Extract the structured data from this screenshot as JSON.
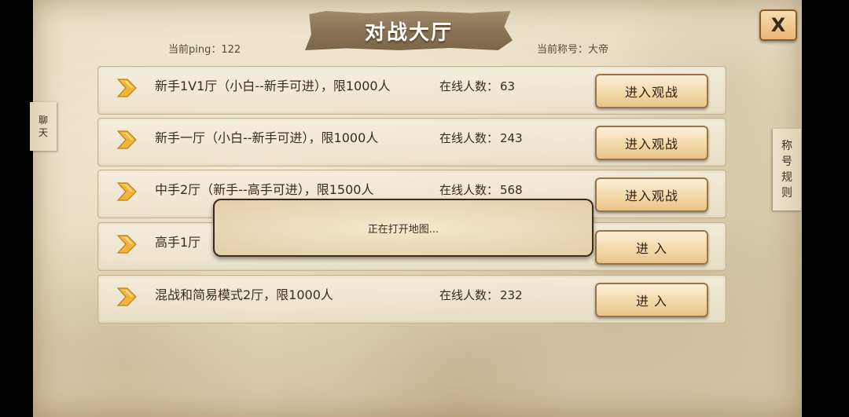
{
  "header": {
    "title": "对战大厅",
    "ping": "当前ping：122",
    "rank": "当前称号：大帝",
    "close_label": "X"
  },
  "side_tabs": {
    "chat": [
      "聊",
      "天"
    ],
    "rules": [
      "称",
      "号",
      "规",
      "则"
    ]
  },
  "rooms": [
    {
      "name": "新手1V1厅（小白--新手可进），限1000人",
      "online_label": "在线人数：",
      "online": "63",
      "button": "进入观战"
    },
    {
      "name": "新手一厅（小白--新手可进），限1000人",
      "online_label": "在线人数：",
      "online": "243",
      "button": "进入观战"
    },
    {
      "name": "中手2厅（新手--高手可进），限1500人",
      "online_label": "在线人数：",
      "online": "568",
      "button": "进入观战"
    },
    {
      "name": "高手1厅",
      "online_label": "",
      "online": "",
      "button": "进  入"
    },
    {
      "name": "混战和简易模式2厅，限1000人",
      "online_label": "在线人数：",
      "online": "232",
      "button": "进  入"
    }
  ],
  "loading": {
    "text": "正在打开地图..."
  },
  "colors": {
    "parchment": "#e3d6ba",
    "banner": "#8a7455",
    "button": "#f3d9aa",
    "chevron": "#f2b43a"
  },
  "icons": {
    "room_marker": "chevron-right-icon",
    "close": "close-icon"
  }
}
